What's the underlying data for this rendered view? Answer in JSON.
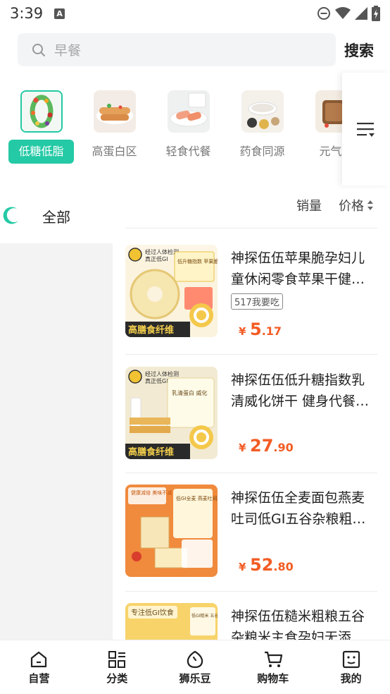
{
  "status_bar": {
    "time": "3:39",
    "notification_badge": "A"
  },
  "search": {
    "placeholder": "早餐",
    "button_label": "搜索"
  },
  "categories": [
    {
      "label": "低糖低脂",
      "active": true
    },
    {
      "label": "高蛋白区",
      "active": false
    },
    {
      "label": "轻食代餐",
      "active": false
    },
    {
      "label": "药食同源",
      "active": false
    },
    {
      "label": "元气早",
      "active": false
    }
  ],
  "sidebar": {
    "items": [
      {
        "label": "全部"
      }
    ]
  },
  "sort": {
    "sales_label": "销量",
    "price_label": "价格"
  },
  "products": [
    {
      "title": "神探伍伍苹果脆孕妇儿童休闲零食苹果干健…",
      "tag": "517我要吃",
      "price_symbol": "¥",
      "price_int": "5",
      "price_dec": ".17"
    },
    {
      "title": "神探伍伍低升糖指数乳清威化饼干 健身代餐…",
      "tag": "",
      "price_symbol": "¥",
      "price_int": "27",
      "price_dec": ".90"
    },
    {
      "title": "神探伍伍全麦面包燕麦吐司低GI五谷杂粮粗…",
      "tag": "",
      "price_symbol": "¥",
      "price_int": "52",
      "price_dec": ".80"
    },
    {
      "title": "神探伍伍糙米粗粮五谷杂粮米主食孕妇无添…",
      "tag": "",
      "price_symbol": "",
      "price_int": "",
      "price_dec": ""
    }
  ],
  "product_images": {
    "p1_badge1": "经过人体检测",
    "p1_badge2": "真正低GI",
    "p1_box": "低升糖指数 苹果脆",
    "p1_bottom": "高膳食纤维",
    "p2_badge1": "经过人体检测",
    "p2_badge2": "真正低GI",
    "p2_box": "乳清蛋白 威化",
    "p2_bottom": "高膳食纤维",
    "p3_badge": "健康减倍 美味不减",
    "p3_box": "低GI全麦 燕麦吐司",
    "p4_badge": "专注低GI饮食",
    "p4_box": "低GI糙米 五谷杂粮米"
  },
  "bottom_nav": [
    {
      "label": "自营",
      "icon": "home-icon"
    },
    {
      "label": "分类",
      "icon": "category-grid-icon"
    },
    {
      "label": "狮乐豆",
      "icon": "bean-icon"
    },
    {
      "label": "购物车",
      "icon": "cart-icon"
    },
    {
      "label": "我的",
      "icon": "profile-icon"
    }
  ],
  "colors": {
    "accent": "#24c9a5",
    "price": "#f25c24",
    "sidebar_bg": "#f3f3f3"
  }
}
